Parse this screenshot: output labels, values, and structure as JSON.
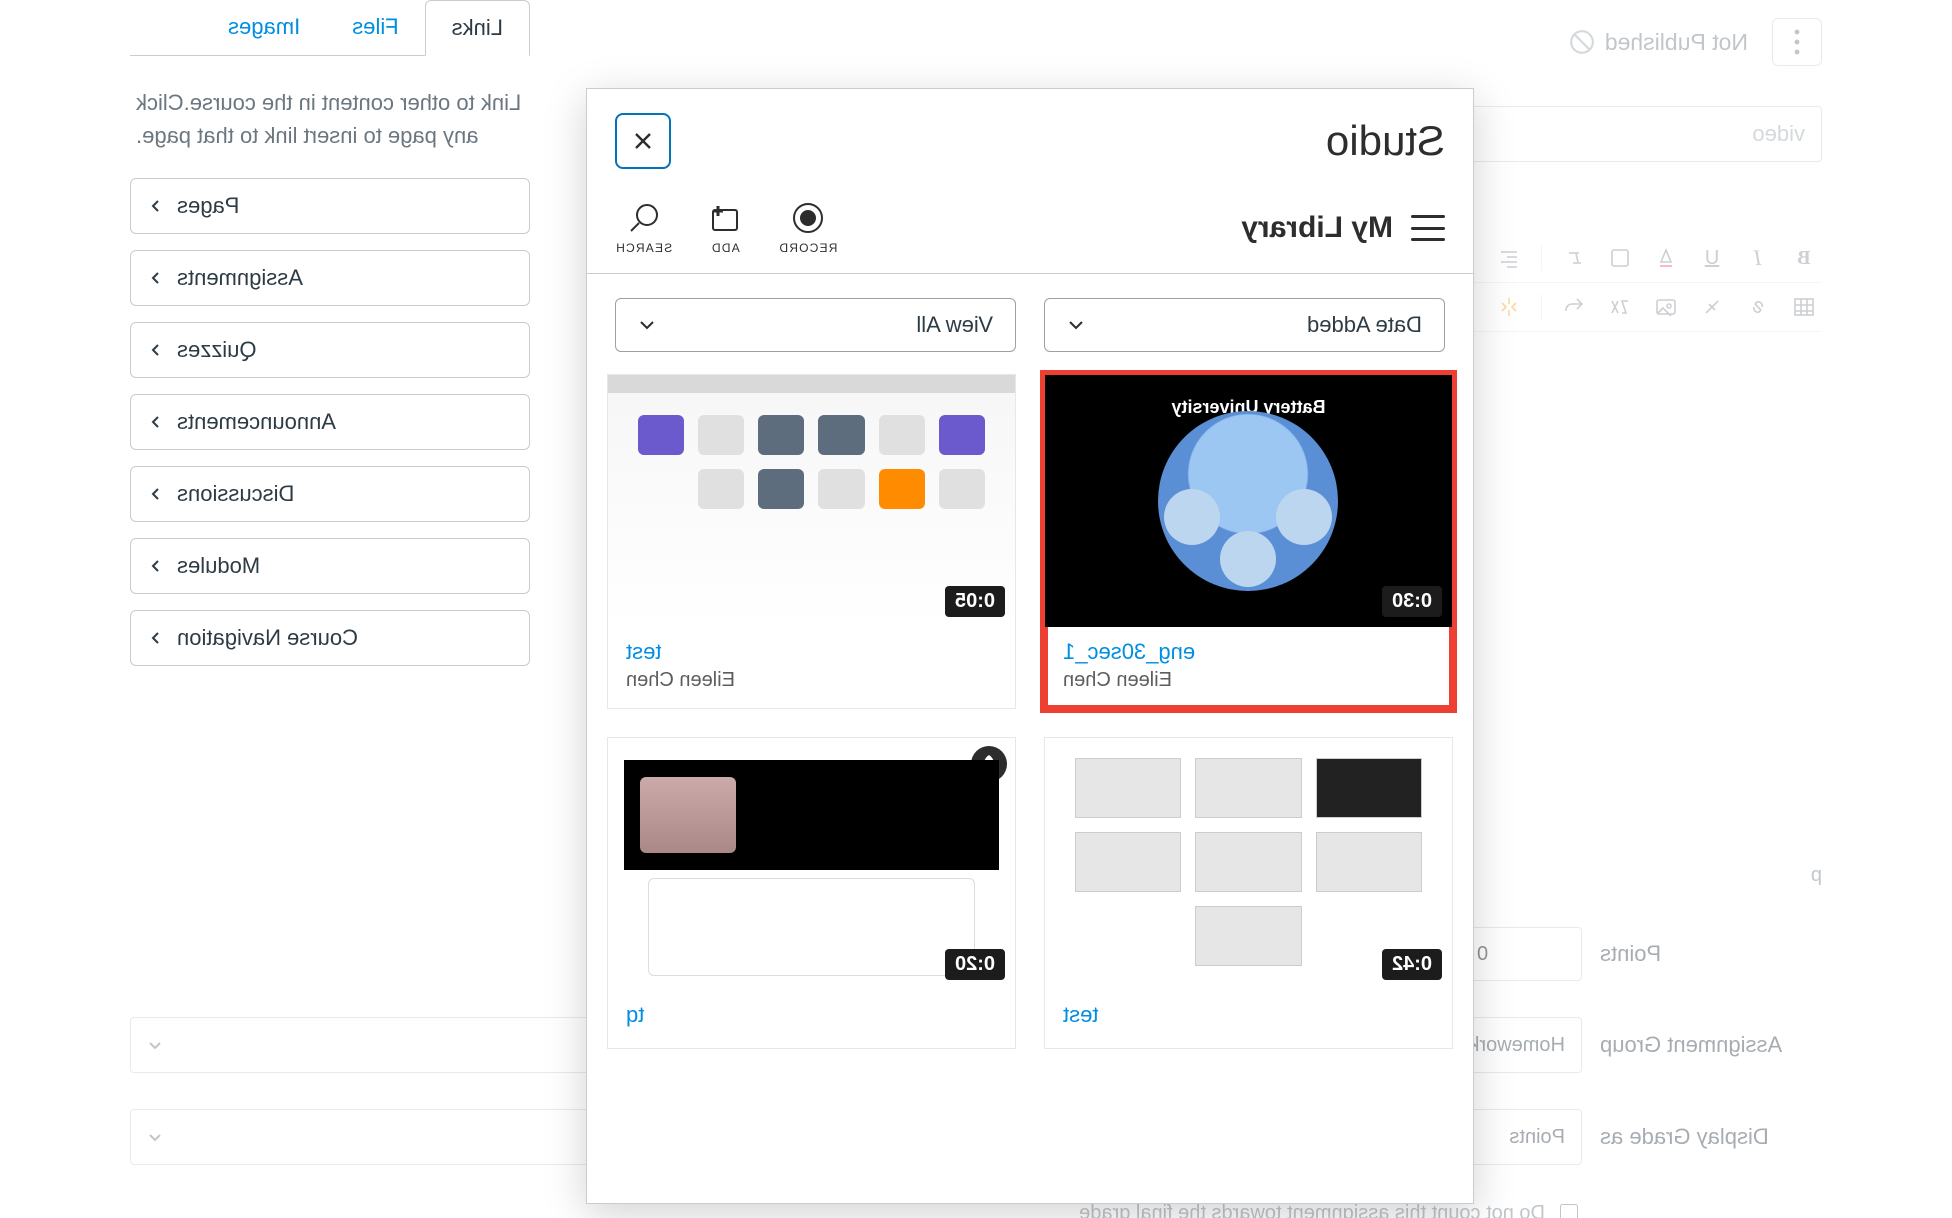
{
  "under": {
    "not_published": "Not Published",
    "title_placeholder": "video",
    "p_tag": "p",
    "points_label": "Points",
    "points_value": "0",
    "group_label": "Assignment Group",
    "group_value": "Homework Assignment",
    "display_label": "Display Grade as",
    "display_value": "Points",
    "checkbox_label": "Do not count this assignment towards the final grade"
  },
  "side": {
    "tabs": {
      "links": "Links",
      "files": "Files",
      "images": "Images"
    },
    "note": "Link to other content in the course.Click any page to insert link to that page.",
    "items": [
      "Pages",
      "Assignments",
      "Quizzes",
      "Announcements",
      "Discussions",
      "Modules",
      "Course Navigation"
    ]
  },
  "modal": {
    "title": "Studio",
    "library": "My Library",
    "tools": {
      "record": "RECORD",
      "add": "ADD",
      "search": "SEARCH"
    },
    "filters": {
      "sort": "Date Added",
      "view": "View All"
    },
    "cards": [
      {
        "title": "eng_30sec_1",
        "author": "Eileen Chen",
        "duration": "0:30",
        "bu_label": "Battery University"
      },
      {
        "title": "test",
        "author": "Eileen Chen",
        "duration": "0:05"
      },
      {
        "title": "test",
        "author": "",
        "duration": "0:42"
      },
      {
        "title": "tq",
        "author": "",
        "duration": "0:20"
      }
    ]
  }
}
